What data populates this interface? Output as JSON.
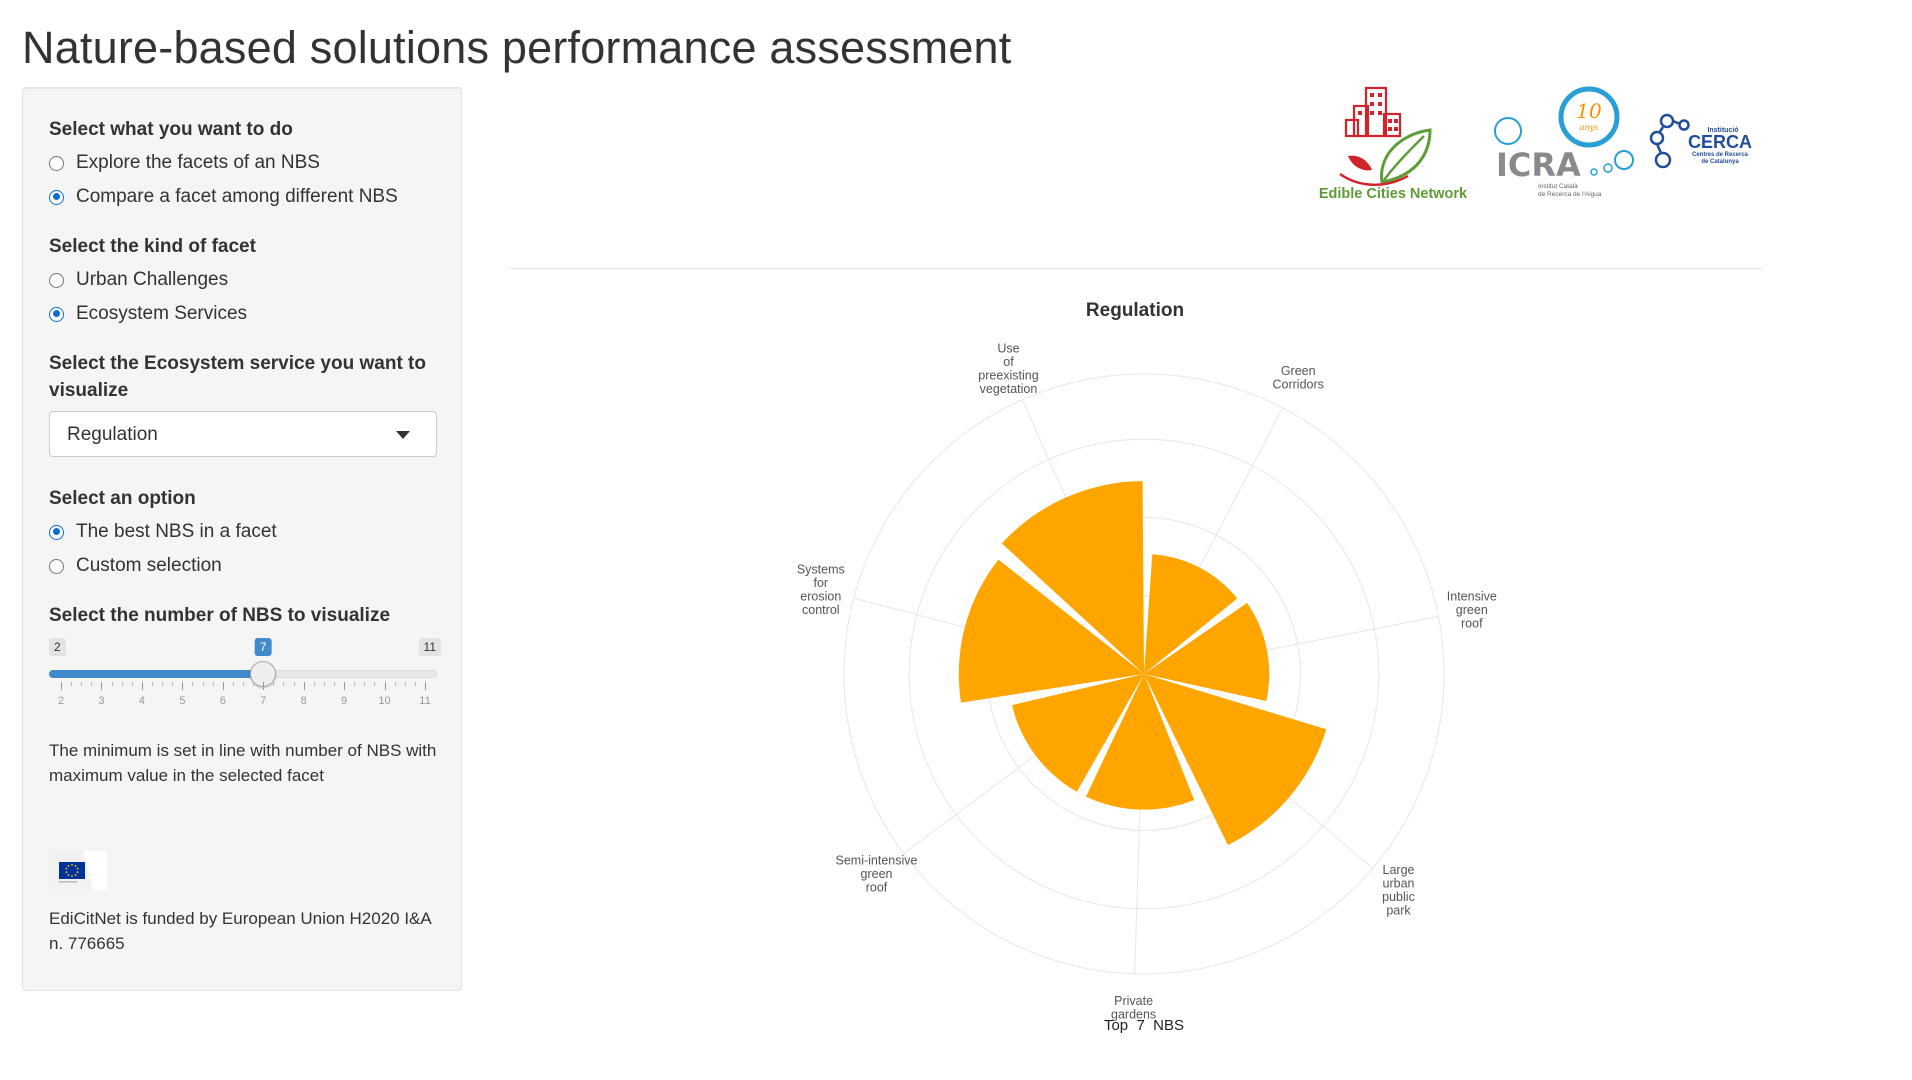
{
  "title": "Nature-based solutions performance assessment",
  "sidebar": {
    "action_label": "Select what you want to do",
    "action_options": [
      {
        "label": "Explore the facets of an NBS",
        "checked": false
      },
      {
        "label": "Compare a facet among different NBS",
        "checked": true
      }
    ],
    "facet_label": "Select the kind of facet",
    "facet_options": [
      {
        "label": "Urban Challenges",
        "checked": false
      },
      {
        "label": "Ecosystem Services",
        "checked": true
      }
    ],
    "service_label": "Select the Ecosystem service you want to visualize",
    "service_selected": "Regulation",
    "option_label": "Select an option",
    "option_options": [
      {
        "label": "The best NBS in a facet",
        "checked": true
      },
      {
        "label": "Custom selection",
        "checked": false
      }
    ],
    "slider_label": "Select the number of NBS to visualize",
    "slider": {
      "min": 2,
      "max": 11,
      "value": 7,
      "min_label": "2",
      "max_label": "11",
      "value_label": "7",
      "ticks": [
        "2",
        "3",
        "4",
        "5",
        "6",
        "7",
        "8",
        "9",
        "10",
        "11"
      ]
    },
    "note": "The minimum is set in line with number of NBS with maximum value in the selected facet",
    "funding": "EdiCitNet is funded by European Union H2020 I&A n. 776665"
  },
  "logos": {
    "edicitnet_text": "Edible Cities Network",
    "icra_text": "ICRA",
    "icra_years": "10",
    "icra_years_word": "anys",
    "icra_sub1": "Institut Català",
    "icra_sub2": "de Recerca de l'Aigua",
    "cerca_small": "Institució",
    "cerca_text": "CERCA",
    "cerca_sub1": "Centres de Recerca",
    "cerca_sub2": "de Catalunya"
  },
  "colors": {
    "bar": "#FFA500",
    "accent": "#0b6cd1",
    "slider": "#428bca"
  },
  "chart_data": {
    "type": "polar-bar",
    "title": "Regulation",
    "xlabel": "Top  7  NBS",
    "categories": [
      {
        "lines": [
          "Green",
          "Corridors"
        ]
      },
      {
        "lines": [
          "Intensive",
          "green",
          "roof"
        ]
      },
      {
        "lines": [
          "Large",
          "urban",
          "public",
          "park"
        ]
      },
      {
        "lines": [
          "Private",
          "gardens"
        ]
      },
      {
        "lines": [
          "Semi-intensive",
          "green",
          "roof"
        ]
      },
      {
        "lines": [
          "Systems",
          "for",
          "erosion",
          "control"
        ]
      },
      {
        "lines": [
          "Use",
          "of",
          "preexisting",
          "vegetation"
        ]
      }
    ],
    "values": [
      0.46,
      0.48,
      0.73,
      0.52,
      0.52,
      0.71,
      0.74
    ],
    "rmax": 1.15,
    "grid": true
  }
}
